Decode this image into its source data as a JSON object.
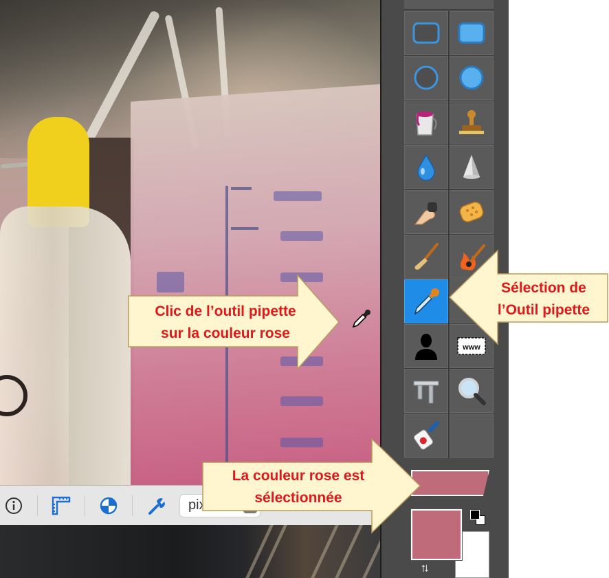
{
  "annotations": {
    "pipette_click_line1": "Clic de l’outil pipette",
    "pipette_click_line2": "sur la couleur rose",
    "selection_line1": "Sélection de",
    "selection_line2": "l’Outil pipette",
    "color_selected_line1": "La couleur rose est",
    "color_selected_line2": "sélectionnée"
  },
  "statusbar": {
    "unit_value": "pixe"
  },
  "tools": [
    {
      "name": "rounded-rect-outline-icon"
    },
    {
      "name": "rounded-rect-filled-icon"
    },
    {
      "name": "ellipse-outline-icon"
    },
    {
      "name": "ellipse-filled-icon"
    },
    {
      "name": "paint-bucket-icon"
    },
    {
      "name": "stamp-icon"
    },
    {
      "name": "water-drop-icon"
    },
    {
      "name": "cone-icon"
    },
    {
      "name": "smudge-finger-icon"
    },
    {
      "name": "sponge-icon"
    },
    {
      "name": "brush-icon"
    },
    {
      "name": "burn-brush-icon"
    },
    {
      "name": "eyedropper-icon",
      "selected": true
    },
    {
      "name": "hidden-tool-icon"
    },
    {
      "name": "silhouette-icon"
    },
    {
      "name": "text-field-icon"
    },
    {
      "name": "caliper-icon"
    },
    {
      "name": "magnifier-icon"
    },
    {
      "name": "glue-icon"
    },
    {
      "name": "empty-slot"
    }
  ],
  "colors": {
    "selected_pink": "#c06b7a",
    "selection_blue": "#1f8ce8",
    "callout_fill": "#fff6cf",
    "callout_text": "#e0171b"
  }
}
